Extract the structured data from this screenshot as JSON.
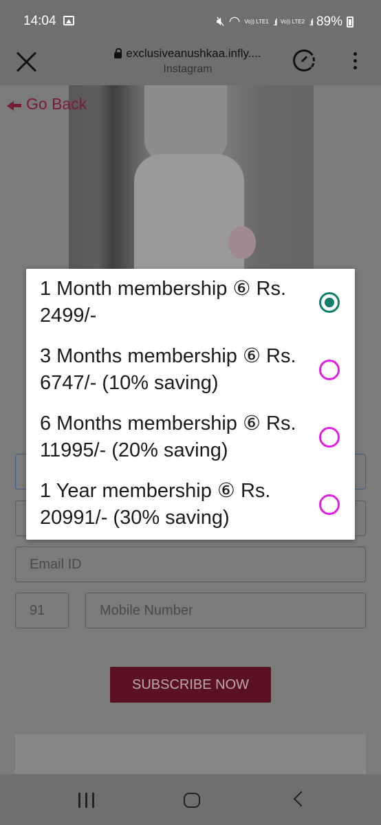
{
  "status_bar": {
    "time": "14:04",
    "network_1": "Vo)) LTE1",
    "network_2": "Vo)) LTE2",
    "battery": "89%"
  },
  "browser": {
    "url": "exclusiveanushkaa.infly....",
    "source": "Instagram"
  },
  "page": {
    "go_back": "Go Back",
    "email_placeholder": "Email ID",
    "country_code": "91",
    "mobile_placeholder": "Mobile Number",
    "subscribe_label": "SUBSCRIBE NOW"
  },
  "dialog": {
    "options": [
      {
        "label": "1 Month membership ⑥ Rs. 2499/-",
        "selected": true
      },
      {
        "label": "3 Months membership ⑥ Rs. 6747/- (10% saving)",
        "selected": false
      },
      {
        "label": "6 Months membership ⑥ Rs. 11995/- (20% saving)",
        "selected": false
      },
      {
        "label": "1 Year membership ⑥ Rs. 20991/- (30% saving)",
        "selected": false
      }
    ]
  },
  "colors": {
    "selected_radio": "#0f7e6e",
    "unselected_radio": "#e21ee2",
    "brand": "#7a1b35"
  }
}
